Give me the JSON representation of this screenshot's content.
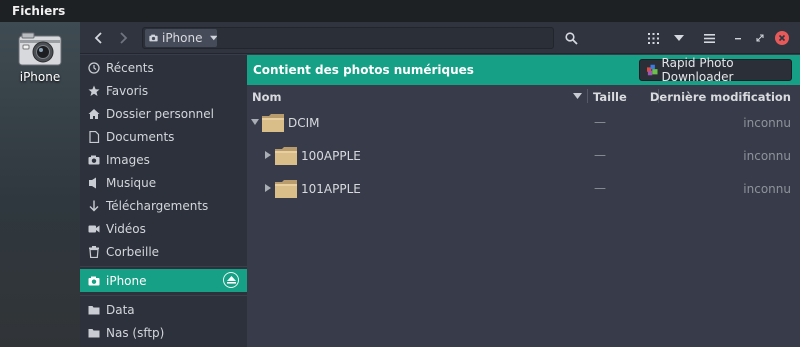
{
  "topbar": {
    "app_name": "Fichiers"
  },
  "desktop": {
    "icon_label": "iPhone"
  },
  "headerbar": {
    "path": "iPhone"
  },
  "sidebar": {
    "places": [
      {
        "label": "Récents",
        "icon": "clock-icon"
      },
      {
        "label": "Favoris",
        "icon": "star-icon"
      },
      {
        "label": "Dossier personnel",
        "icon": "home-icon"
      },
      {
        "label": "Documents",
        "icon": "document-icon"
      },
      {
        "label": "Images",
        "icon": "camera-icon"
      },
      {
        "label": "Musique",
        "icon": "music-icon"
      },
      {
        "label": "Téléchargements",
        "icon": "download-icon"
      },
      {
        "label": "Vidéos",
        "icon": "video-icon"
      },
      {
        "label": "Corbeille",
        "icon": "trash-icon"
      }
    ],
    "devices": [
      {
        "label": "iPhone",
        "icon": "camera-icon",
        "active": true
      }
    ],
    "network": [
      {
        "label": "Data",
        "icon": "folder-icon"
      },
      {
        "label": "Nas (sftp)",
        "icon": "folder-icon"
      }
    ]
  },
  "infobar": {
    "message": "Contient des photos numériques",
    "button_label": "Rapid Photo Downloader"
  },
  "columns": {
    "name": "Nom",
    "size": "Taille",
    "modified": "Dernière modification"
  },
  "files": [
    {
      "name": "DCIM",
      "size": "—",
      "modified": "inconnu",
      "expanded": true,
      "depth": 0
    },
    {
      "name": "100APPLE",
      "size": "—",
      "modified": "inconnu",
      "expanded": false,
      "depth": 1
    },
    {
      "name": "101APPLE",
      "size": "—",
      "modified": "inconnu",
      "expanded": false,
      "depth": 1
    }
  ],
  "colors": {
    "accent": "#16a085",
    "window_bg": "#383c4a",
    "sidebar_bg": "#2d313b",
    "header_bg": "#2f343f",
    "close": "#e85a5a"
  }
}
